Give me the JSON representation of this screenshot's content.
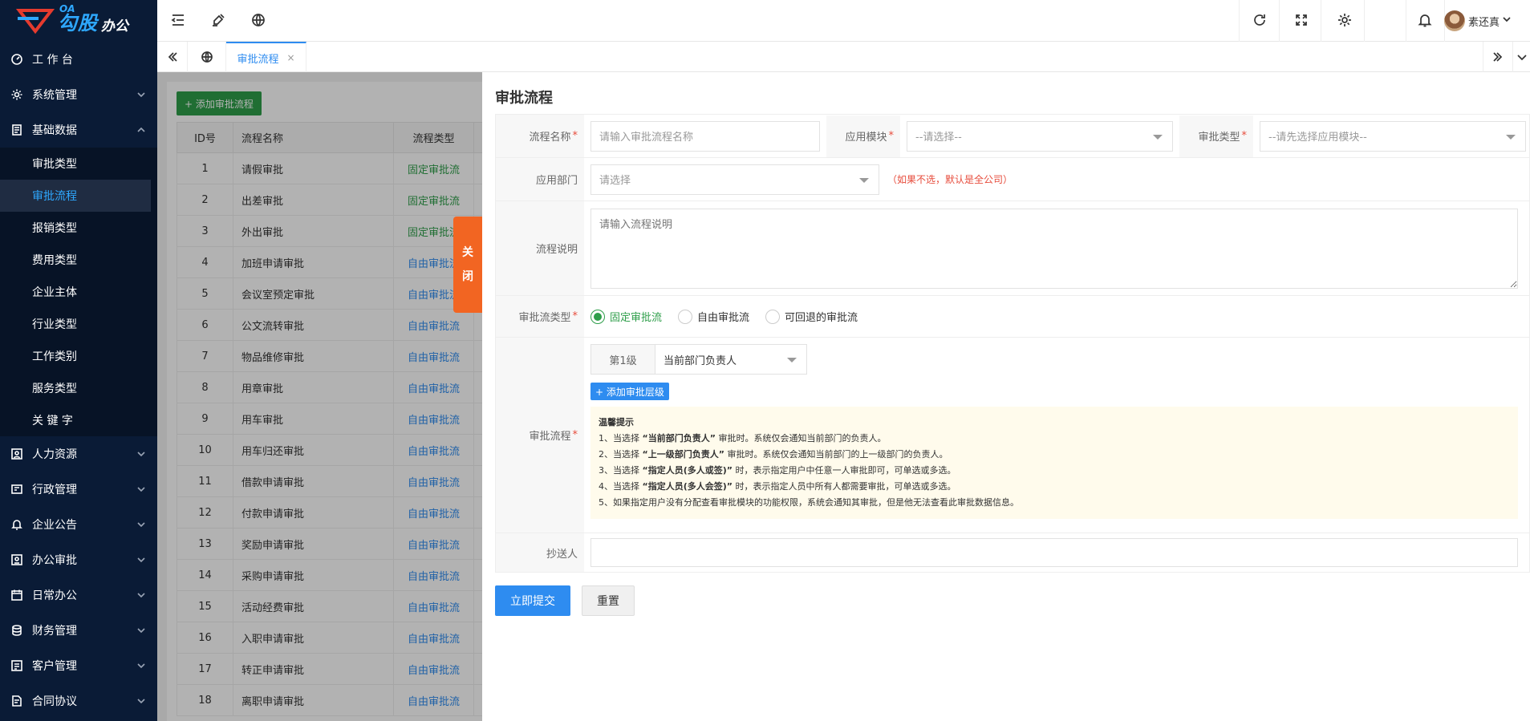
{
  "brand": {
    "oa": "OA",
    "name": "勾股",
    "sub": "办公"
  },
  "sidebar": {
    "items": [
      {
        "label": "工 作 台",
        "icon": "dashboard-icon"
      },
      {
        "label": "系统管理",
        "icon": "settings-icon"
      },
      {
        "label": "基础数据",
        "icon": "database-icon",
        "expanded": true,
        "children": [
          "审批类型",
          "审批流程",
          "报销类型",
          "费用类型",
          "企业主体",
          "行业类型",
          "工作类别",
          "服务类型",
          "关 键 字"
        ],
        "active_child": "审批流程"
      },
      {
        "label": "人力资源",
        "icon": "person-icon"
      },
      {
        "label": "行政管理",
        "icon": "admin-icon"
      },
      {
        "label": "企业公告",
        "icon": "bell-icon"
      },
      {
        "label": "办公审批",
        "icon": "approval-icon"
      },
      {
        "label": "日常办公",
        "icon": "calendar-icon"
      },
      {
        "label": "财务管理",
        "icon": "finance-icon"
      },
      {
        "label": "客户管理",
        "icon": "customer-icon"
      },
      {
        "label": "合同协议",
        "icon": "contract-icon"
      }
    ]
  },
  "topbar": {
    "user_name": "素还真"
  },
  "tabs": {
    "active": "审批流程",
    "close": "×"
  },
  "list": {
    "add_button": "+ 添加审批流程",
    "columns": [
      "ID号",
      "流程名称",
      "流程类型"
    ],
    "rows": [
      [
        "1",
        "请假审批",
        "固定审批流"
      ],
      [
        "2",
        "出差审批",
        "固定审批流"
      ],
      [
        "3",
        "外出审批",
        "固定审批流"
      ],
      [
        "4",
        "加班申请审批",
        "自由审批流"
      ],
      [
        "5",
        "会议室预定审批",
        "自由审批流"
      ],
      [
        "6",
        "公文流转审批",
        "自由审批流"
      ],
      [
        "7",
        "物品维修审批",
        "自由审批流"
      ],
      [
        "8",
        "用章审批",
        "自由审批流"
      ],
      [
        "9",
        "用车审批",
        "自由审批流"
      ],
      [
        "10",
        "用车归还审批",
        "自由审批流"
      ],
      [
        "11",
        "借款申请审批",
        "自由审批流"
      ],
      [
        "12",
        "付款申请审批",
        "自由审批流"
      ],
      [
        "13",
        "奖励申请审批",
        "自由审批流"
      ],
      [
        "14",
        "采购申请审批",
        "自由审批流"
      ],
      [
        "15",
        "活动经费审批",
        "自由审批流"
      ],
      [
        "16",
        "入职申请审批",
        "自由审批流"
      ],
      [
        "17",
        "转正申请审批",
        "自由审批流"
      ],
      [
        "18",
        "离职申请审批",
        "自由审批流"
      ]
    ]
  },
  "close_tab": [
    "关",
    "闭"
  ],
  "drawer": {
    "title": "审批流程",
    "fields": {
      "name_label": "流程名称",
      "name_placeholder": "请输入审批流程名称",
      "module_label": "应用模块",
      "module_placeholder": "--请选择--",
      "type_label": "审批类型",
      "type_placeholder": "--请先选择应用模块--",
      "dept_label": "应用部门",
      "dept_placeholder": "请选择",
      "dept_hint": "（如果不选，默认是全公司）",
      "desc_label": "流程说明",
      "desc_placeholder": "请输入流程说明",
      "flowtype_label": "审批流类型",
      "flowtype_options": [
        "固定审批流",
        "自由审批流",
        "可回退的审批流"
      ],
      "flowtype_selected": "固定审批流",
      "flow_label": "审批流程",
      "level_tag": "第1级",
      "level_value": "当前部门负责人",
      "add_level": "+ 添加审批层级",
      "tips_title": "温馨提示",
      "tips": [
        {
          "pre": "1、当选择 ",
          "bold": "“当前部门负责人”",
          "post": " 审批时。系统仅会通知当前部门的负责人。"
        },
        {
          "pre": "2、当选择 ",
          "bold": "“上一级部门负责人”",
          "post": " 审批时。系统仅会通知当前部门的上一级部门的负责人。"
        },
        {
          "pre": "3、当选择 ",
          "bold": "“指定人员(多人或签)”",
          "post": " 时，表示指定用户中任意一人审批即可，可单选或多选。"
        },
        {
          "pre": "4、当选择 ",
          "bold": "“指定人员(多人会签)”",
          "post": " 时，表示指定人员中所有人都需要审批，可单选或多选。"
        },
        {
          "pre": "5、如果指定用户没有分配查看审批模块的功能权限，系统会通知其审批，但是他无法查看此审批数据信息。",
          "bold": "",
          "post": ""
        }
      ],
      "cc_label": "抄送人"
    },
    "submit": "立即提交",
    "reset": "重置"
  }
}
